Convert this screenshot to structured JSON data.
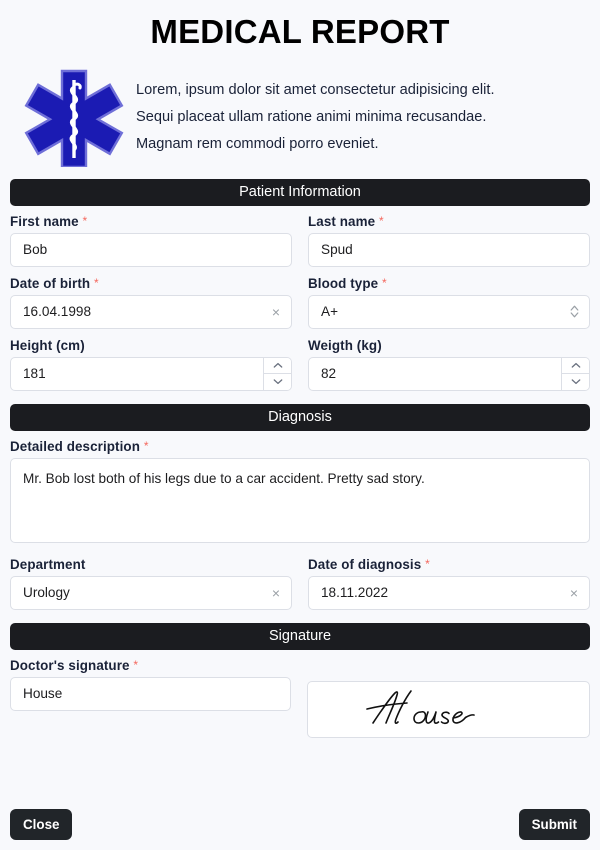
{
  "header": {
    "title": "MEDICAL REPORT",
    "logo_icon": "star-of-life-icon",
    "intro_text": "Lorem, ipsum dolor sit amet consectetur adipisicing elit.\nSequi placeat ullam ratione animi minima recusandae.\nMagnam rem commodi porro eveniet."
  },
  "sections": {
    "patient": "Patient Information",
    "diagnosis": "Diagnosis",
    "signature": "Signature"
  },
  "fields": {
    "first_name": {
      "label": "First name",
      "required": "*",
      "value": "Bob"
    },
    "last_name": {
      "label": "Last name",
      "required": "*",
      "value": "Spud"
    },
    "date_of_birth": {
      "label": "Date of birth",
      "required": "*",
      "value": "16.04.1998",
      "clear_icon": "×"
    },
    "blood_type": {
      "label": "Blood type",
      "required": "*",
      "value": "A+"
    },
    "height": {
      "label": "Height (cm)",
      "required": "",
      "value": "181"
    },
    "weight": {
      "label": "Weigth (kg)",
      "required": "",
      "value": "82"
    },
    "description": {
      "label": "Detailed description",
      "required": "*",
      "value": "Mr. Bob lost both of his legs due to a car accident. Pretty sad story."
    },
    "department": {
      "label": "Department",
      "required": "",
      "value": "Urology",
      "clear_icon": "×"
    },
    "date_of_diagnosis": {
      "label": "Date of diagnosis",
      "required": "*",
      "value": "18.11.2022",
      "clear_icon": "×"
    },
    "doctor_signature": {
      "label": "Doctor's signature",
      "required": "*",
      "value": "House",
      "preview": "House"
    }
  },
  "footer": {
    "close_label": "Close",
    "submit_label": "Submit"
  },
  "colors": {
    "page_background": "#f8f9fc",
    "section_bar": "#1b1c20",
    "button": "#212529",
    "required_asterisk": "#f4685e",
    "logo_blue": "#1b1bb3",
    "label_text": "#1a2238",
    "field_border": "#dcdfe6"
  }
}
